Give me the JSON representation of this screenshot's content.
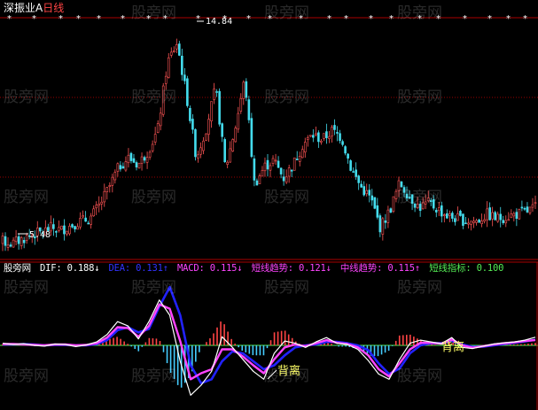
{
  "header": {
    "stock_name": "深振业A",
    "period": "日线"
  },
  "colors": {
    "background": "#000000",
    "frame": "#aa0000",
    "candle_up": "#ff5555",
    "candle_down": "#44ddee",
    "dif": "#ffffff",
    "dea": "#2222ff",
    "macd_pos": "#ff4444",
    "macd_neg": "#44ccff",
    "short_trend": "#ff44ff",
    "mid_trend": "#ff44ff",
    "short_indicator": "#55ee55"
  },
  "watermark": "股旁网",
  "indicator_legend": {
    "name": "股旁网",
    "dif": "DIF: 0.188↓",
    "dea": "DEA: 0.131↑",
    "macd": "MACD: 0.115↓",
    "short_trend": "短线趋势: 0.121↓",
    "mid_trend": "中线趋势: 0.115↑",
    "short_indicator": "短线指标: 0.100"
  },
  "chart_data": [
    {
      "type": "candlestick",
      "title": "深振业A 日线",
      "ylim": [
        4.8,
        15.5
      ],
      "annotations": {
        "high_label": "14.84",
        "low_label": "5.48"
      },
      "close_path": [
        5.6,
        5.5,
        5.7,
        5.9,
        6.0,
        6.2,
        6.1,
        6.3,
        6.5,
        6.6,
        7.2,
        8.0,
        8.9,
        9.3,
        9.0,
        9.6,
        10.5,
        13.5,
        14.4,
        12.0,
        9.3,
        10.6,
        12.4,
        8.8,
        10.6,
        12.8,
        8.1,
        8.9,
        9.2,
        8.4,
        9.0,
        9.9,
        10.3,
        10.1,
        10.5,
        10.2,
        8.8,
        8.0,
        7.5,
        6.2,
        7.0,
        8.2,
        7.6,
        7.1,
        7.3,
        7.0,
        6.7,
        6.6,
        6.5,
        6.5,
        6.8,
        6.6,
        6.7,
        6.8,
        6.9,
        7.1
      ]
    },
    {
      "type": "line",
      "title": "",
      "ylim": [
        -1.6,
        1.6
      ],
      "series": [
        {
          "name": "DIF",
          "values": [
            0.05,
            0.02,
            0.04,
            0.0,
            -0.02,
            0.03,
            0.02,
            -0.03,
            0.01,
            0.08,
            0.25,
            0.55,
            0.45,
            0.15,
            0.55,
            1.05,
            0.7,
            -0.4,
            -1.25,
            -1.0,
            -0.65,
            0.2,
            -0.05,
            -0.35,
            -0.65,
            -0.85,
            -0.2,
            0.1,
            0.05,
            -0.05,
            0.08,
            0.18,
            0.05,
            0.02,
            -0.1,
            -0.38,
            -0.72,
            -0.85,
            -0.35,
            0.05,
            0.12,
            0.08,
            0.04,
            0.18,
            -0.05,
            -0.08,
            -0.02,
            0.03,
            0.06,
            0.08,
            0.12,
            0.188
          ]
        },
        {
          "name": "DEA",
          "values": [
            0.02,
            0.02,
            0.03,
            0.02,
            0.0,
            0.01,
            0.01,
            0.0,
            0.0,
            0.03,
            0.12,
            0.35,
            0.42,
            0.3,
            0.38,
            0.9,
            1.35,
            0.7,
            -0.5,
            -0.95,
            -0.85,
            -0.4,
            -0.15,
            -0.2,
            -0.4,
            -0.6,
            -0.5,
            -0.25,
            -0.05,
            0.0,
            0.02,
            0.08,
            0.08,
            0.05,
            0.0,
            -0.12,
            -0.45,
            -0.72,
            -0.58,
            -0.2,
            0.0,
            0.05,
            0.05,
            0.1,
            0.02,
            -0.04,
            -0.03,
            0.0,
            0.03,
            0.06,
            0.09,
            0.131
          ]
        },
        {
          "name": "短线趋势",
          "values": [
            0.03,
            0.03,
            0.02,
            0.01,
            0.0,
            0.02,
            0.02,
            0.0,
            0.01,
            0.05,
            0.18,
            0.42,
            0.4,
            0.2,
            0.45,
            0.95,
            0.85,
            0.1,
            -0.85,
            -0.7,
            -0.6,
            -0.1,
            -0.1,
            -0.28,
            -0.5,
            -0.7,
            -0.35,
            -0.05,
            0.02,
            -0.02,
            0.05,
            0.12,
            0.06,
            0.03,
            -0.05,
            -0.25,
            -0.6,
            -0.78,
            -0.45,
            -0.1,
            0.06,
            0.06,
            0.04,
            0.14,
            0.0,
            -0.06,
            -0.02,
            0.02,
            0.05,
            0.07,
            0.1,
            0.121
          ]
        }
      ],
      "histogram": {
        "name": "MACD",
        "values": [
          0.03,
          0.0,
          0.01,
          -0.02,
          -0.02,
          0.02,
          0.01,
          -0.03,
          0.01,
          0.05,
          0.13,
          0.2,
          0.03,
          -0.15,
          0.17,
          0.15,
          -0.65,
          -1.1,
          -0.75,
          -0.05,
          0.2,
          0.6,
          0.1,
          -0.15,
          -0.25,
          -0.25,
          0.3,
          0.35,
          0.1,
          -0.05,
          0.06,
          0.1,
          -0.03,
          -0.03,
          -0.1,
          -0.26,
          -0.27,
          -0.13,
          0.23,
          0.25,
          0.12,
          0.03,
          -0.01,
          0.08,
          -0.07,
          -0.04,
          0.01,
          0.03,
          0.03,
          0.02,
          0.03,
          0.057
        ]
      },
      "annotations": [
        "背离",
        "背离"
      ]
    }
  ]
}
